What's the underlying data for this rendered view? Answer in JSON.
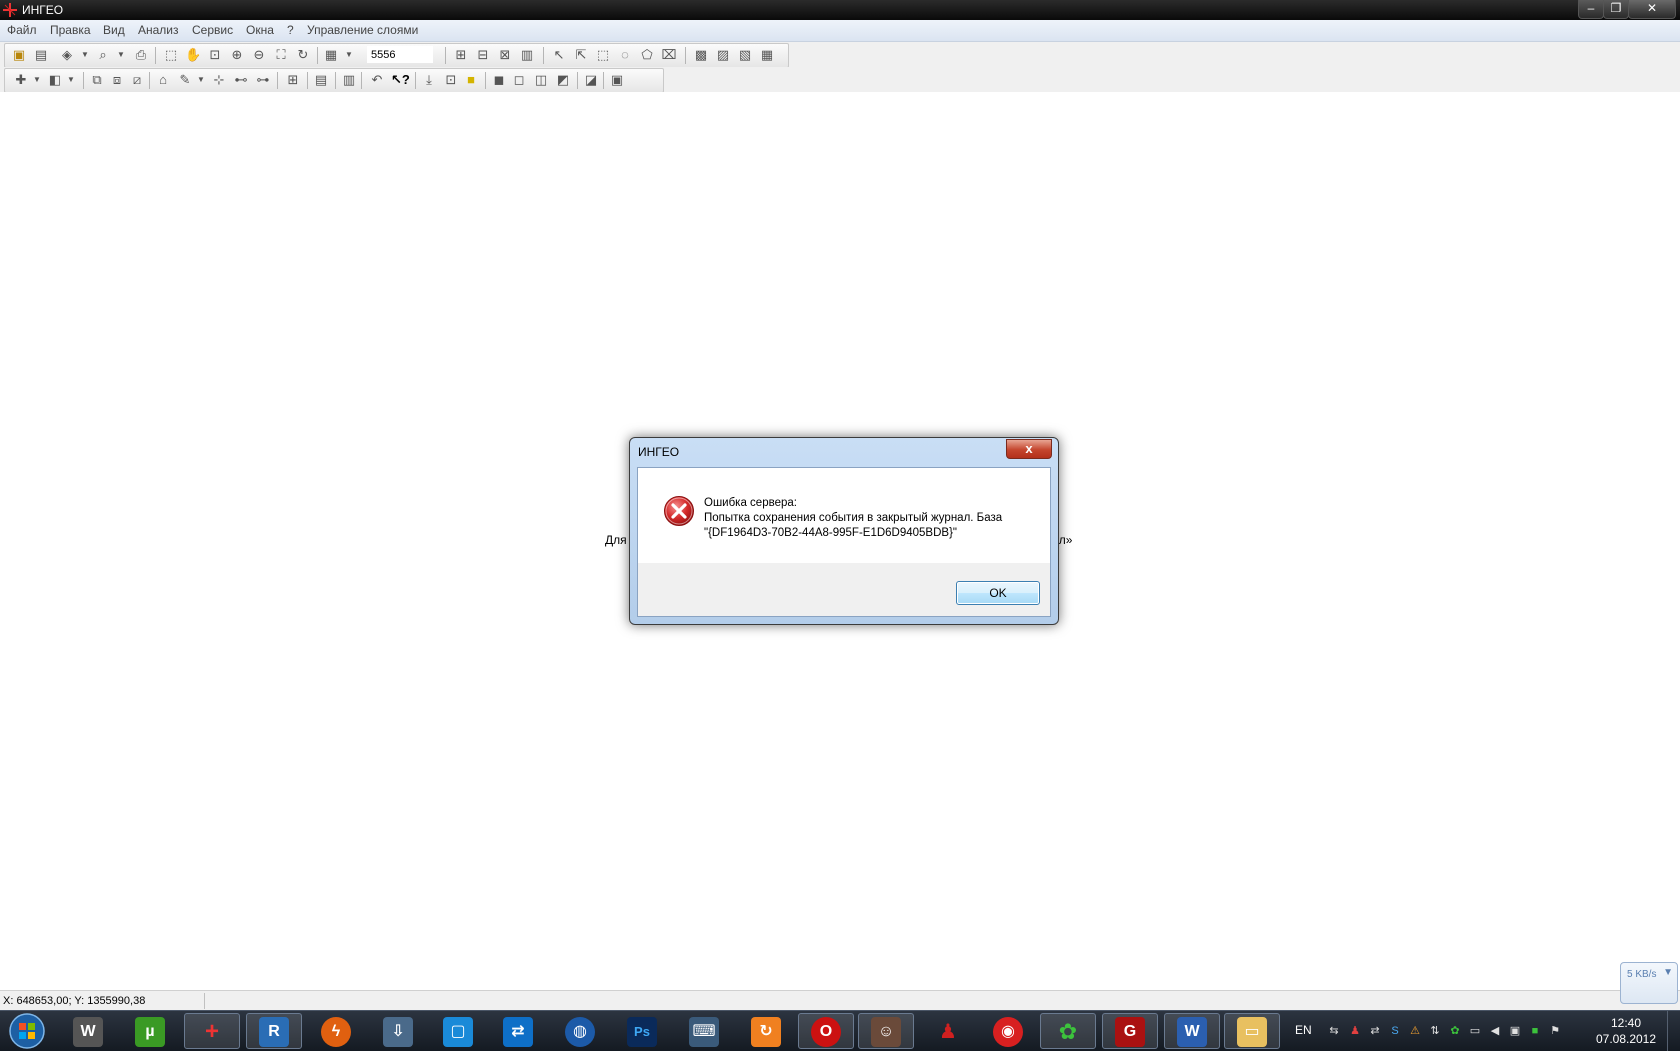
{
  "window": {
    "title": "ИНГЕО",
    "controls": {
      "minimize": "–",
      "restore": "❐",
      "close": "✕"
    }
  },
  "menu": {
    "items": [
      "Файл",
      "Правка",
      "Вид",
      "Анализ",
      "Сервис",
      "Окна",
      "?",
      "Управление слоями"
    ]
  },
  "toolbar": {
    "scale_value": "5556"
  },
  "workspace": {
    "hint_left": "Для",
    "hint_right": "йл»"
  },
  "dialog": {
    "title": "ИНГЕО",
    "close_label": "x",
    "message_line1": "Ошибка сервера:",
    "message_line2": "Попытка сохранения события в закрытый журнал. База",
    "message_line3": "\"{DF1964D3-70B2-44A8-995F-E1D6D9405BDB}\"",
    "ok_label": "OK"
  },
  "statusbar": {
    "coords": "X: 648653,00; Y: 1355990,38"
  },
  "netmeter": {
    "speed": "5 KB/s"
  },
  "taskbar": {
    "language": "EN",
    "time": "12:40",
    "date": "07.08.2012"
  },
  "colors": {
    "titlebar": "#0a0a0a",
    "dialog_frame": "#c9def5",
    "error_red": "#c0282a",
    "taskbar": "#141a22"
  }
}
